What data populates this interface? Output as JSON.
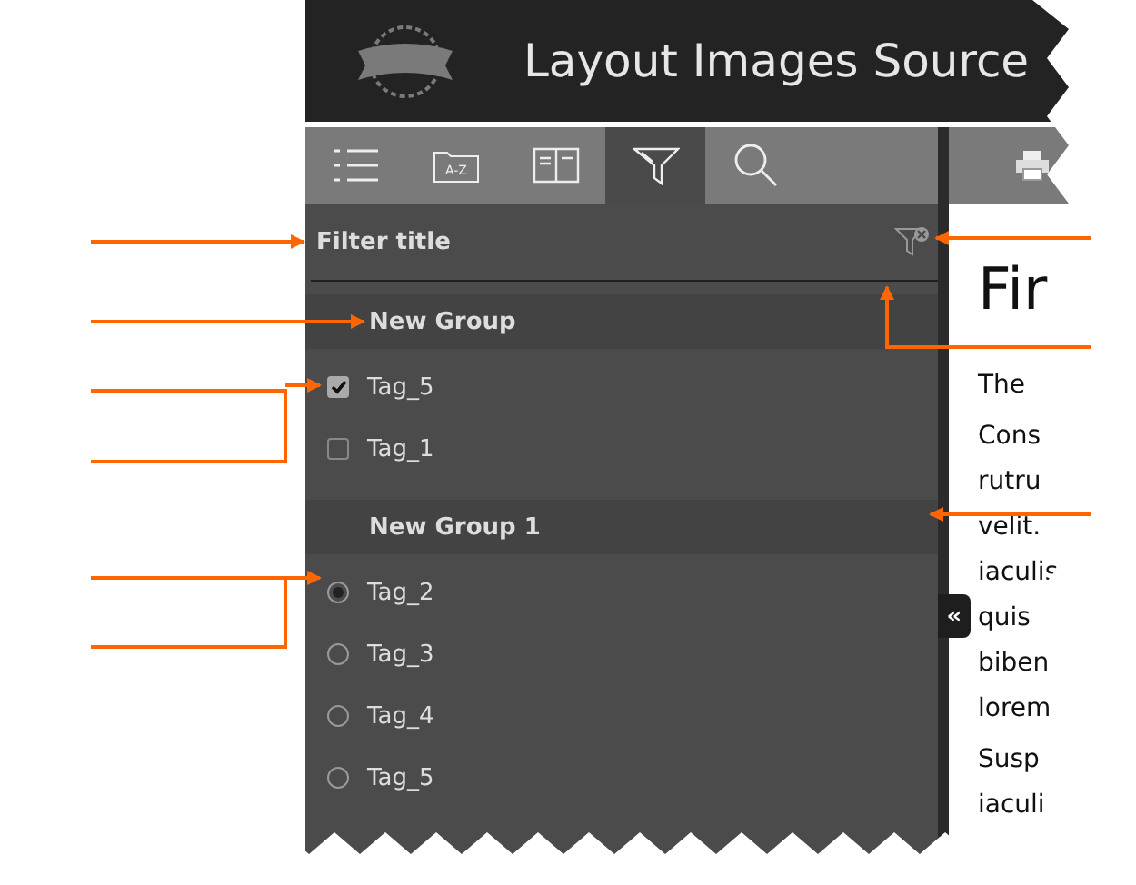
{
  "header": {
    "title": "Layout Images Source"
  },
  "toolbar": {
    "tabs": [
      {
        "kind": "contents",
        "selected": false
      },
      {
        "kind": "index",
        "label": "A-Z",
        "selected": false
      },
      {
        "kind": "glossary",
        "selected": false
      },
      {
        "kind": "filter",
        "selected": true
      },
      {
        "kind": "search",
        "selected": false
      }
    ]
  },
  "filter": {
    "title": "Filter title",
    "groups": [
      {
        "name": "New Group",
        "kind": "checkbox",
        "tags": [
          {
            "label": "Tag_5",
            "checked": true
          },
          {
            "label": "Tag_1",
            "checked": false
          }
        ]
      },
      {
        "name": "New Group 1",
        "kind": "radio",
        "tags": [
          {
            "label": "Tag_2",
            "checked": true
          },
          {
            "label": "Tag_3",
            "checked": false
          },
          {
            "label": "Tag_4",
            "checked": false
          },
          {
            "label": "Tag_5",
            "checked": false
          }
        ]
      }
    ]
  },
  "collapse_button": "«",
  "content": {
    "heading": "Fir",
    "paragraphs": [
      [
        "The"
      ],
      [
        "Cons",
        "rutru",
        "velit.",
        "iaculis",
        "quis",
        "biben",
        "lorem"
      ],
      [
        "Susp",
        "iaculi"
      ]
    ]
  }
}
